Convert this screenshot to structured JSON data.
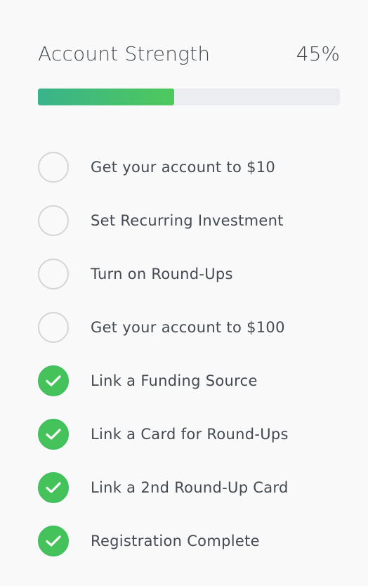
{
  "account_strength": {
    "title": "Account Strength",
    "percent_label": "45%",
    "progress_fraction": 0.45,
    "colors": {
      "fill_start": "#39b38a",
      "fill_end": "#4fc95c",
      "track": "#ebedf0",
      "check": "#45c35a"
    }
  },
  "checklist": [
    {
      "label": "Get your account to $10",
      "completed": false,
      "icon": "empty-circle-icon"
    },
    {
      "label": "Set Recurring Investment",
      "completed": false,
      "icon": "empty-circle-icon"
    },
    {
      "label": "Turn on Round-Ups",
      "completed": false,
      "icon": "empty-circle-icon"
    },
    {
      "label": "Get your account to $100",
      "completed": false,
      "icon": "empty-circle-icon"
    },
    {
      "label": "Link a Funding Source",
      "completed": true,
      "icon": "check-circle-icon"
    },
    {
      "label": "Link a Card for Round-Ups",
      "completed": true,
      "icon": "check-circle-icon"
    },
    {
      "label": "Link a 2nd Round-Up Card",
      "completed": true,
      "icon": "check-circle-icon"
    },
    {
      "label": "Registration Complete",
      "completed": true,
      "icon": "check-circle-icon"
    }
  ]
}
